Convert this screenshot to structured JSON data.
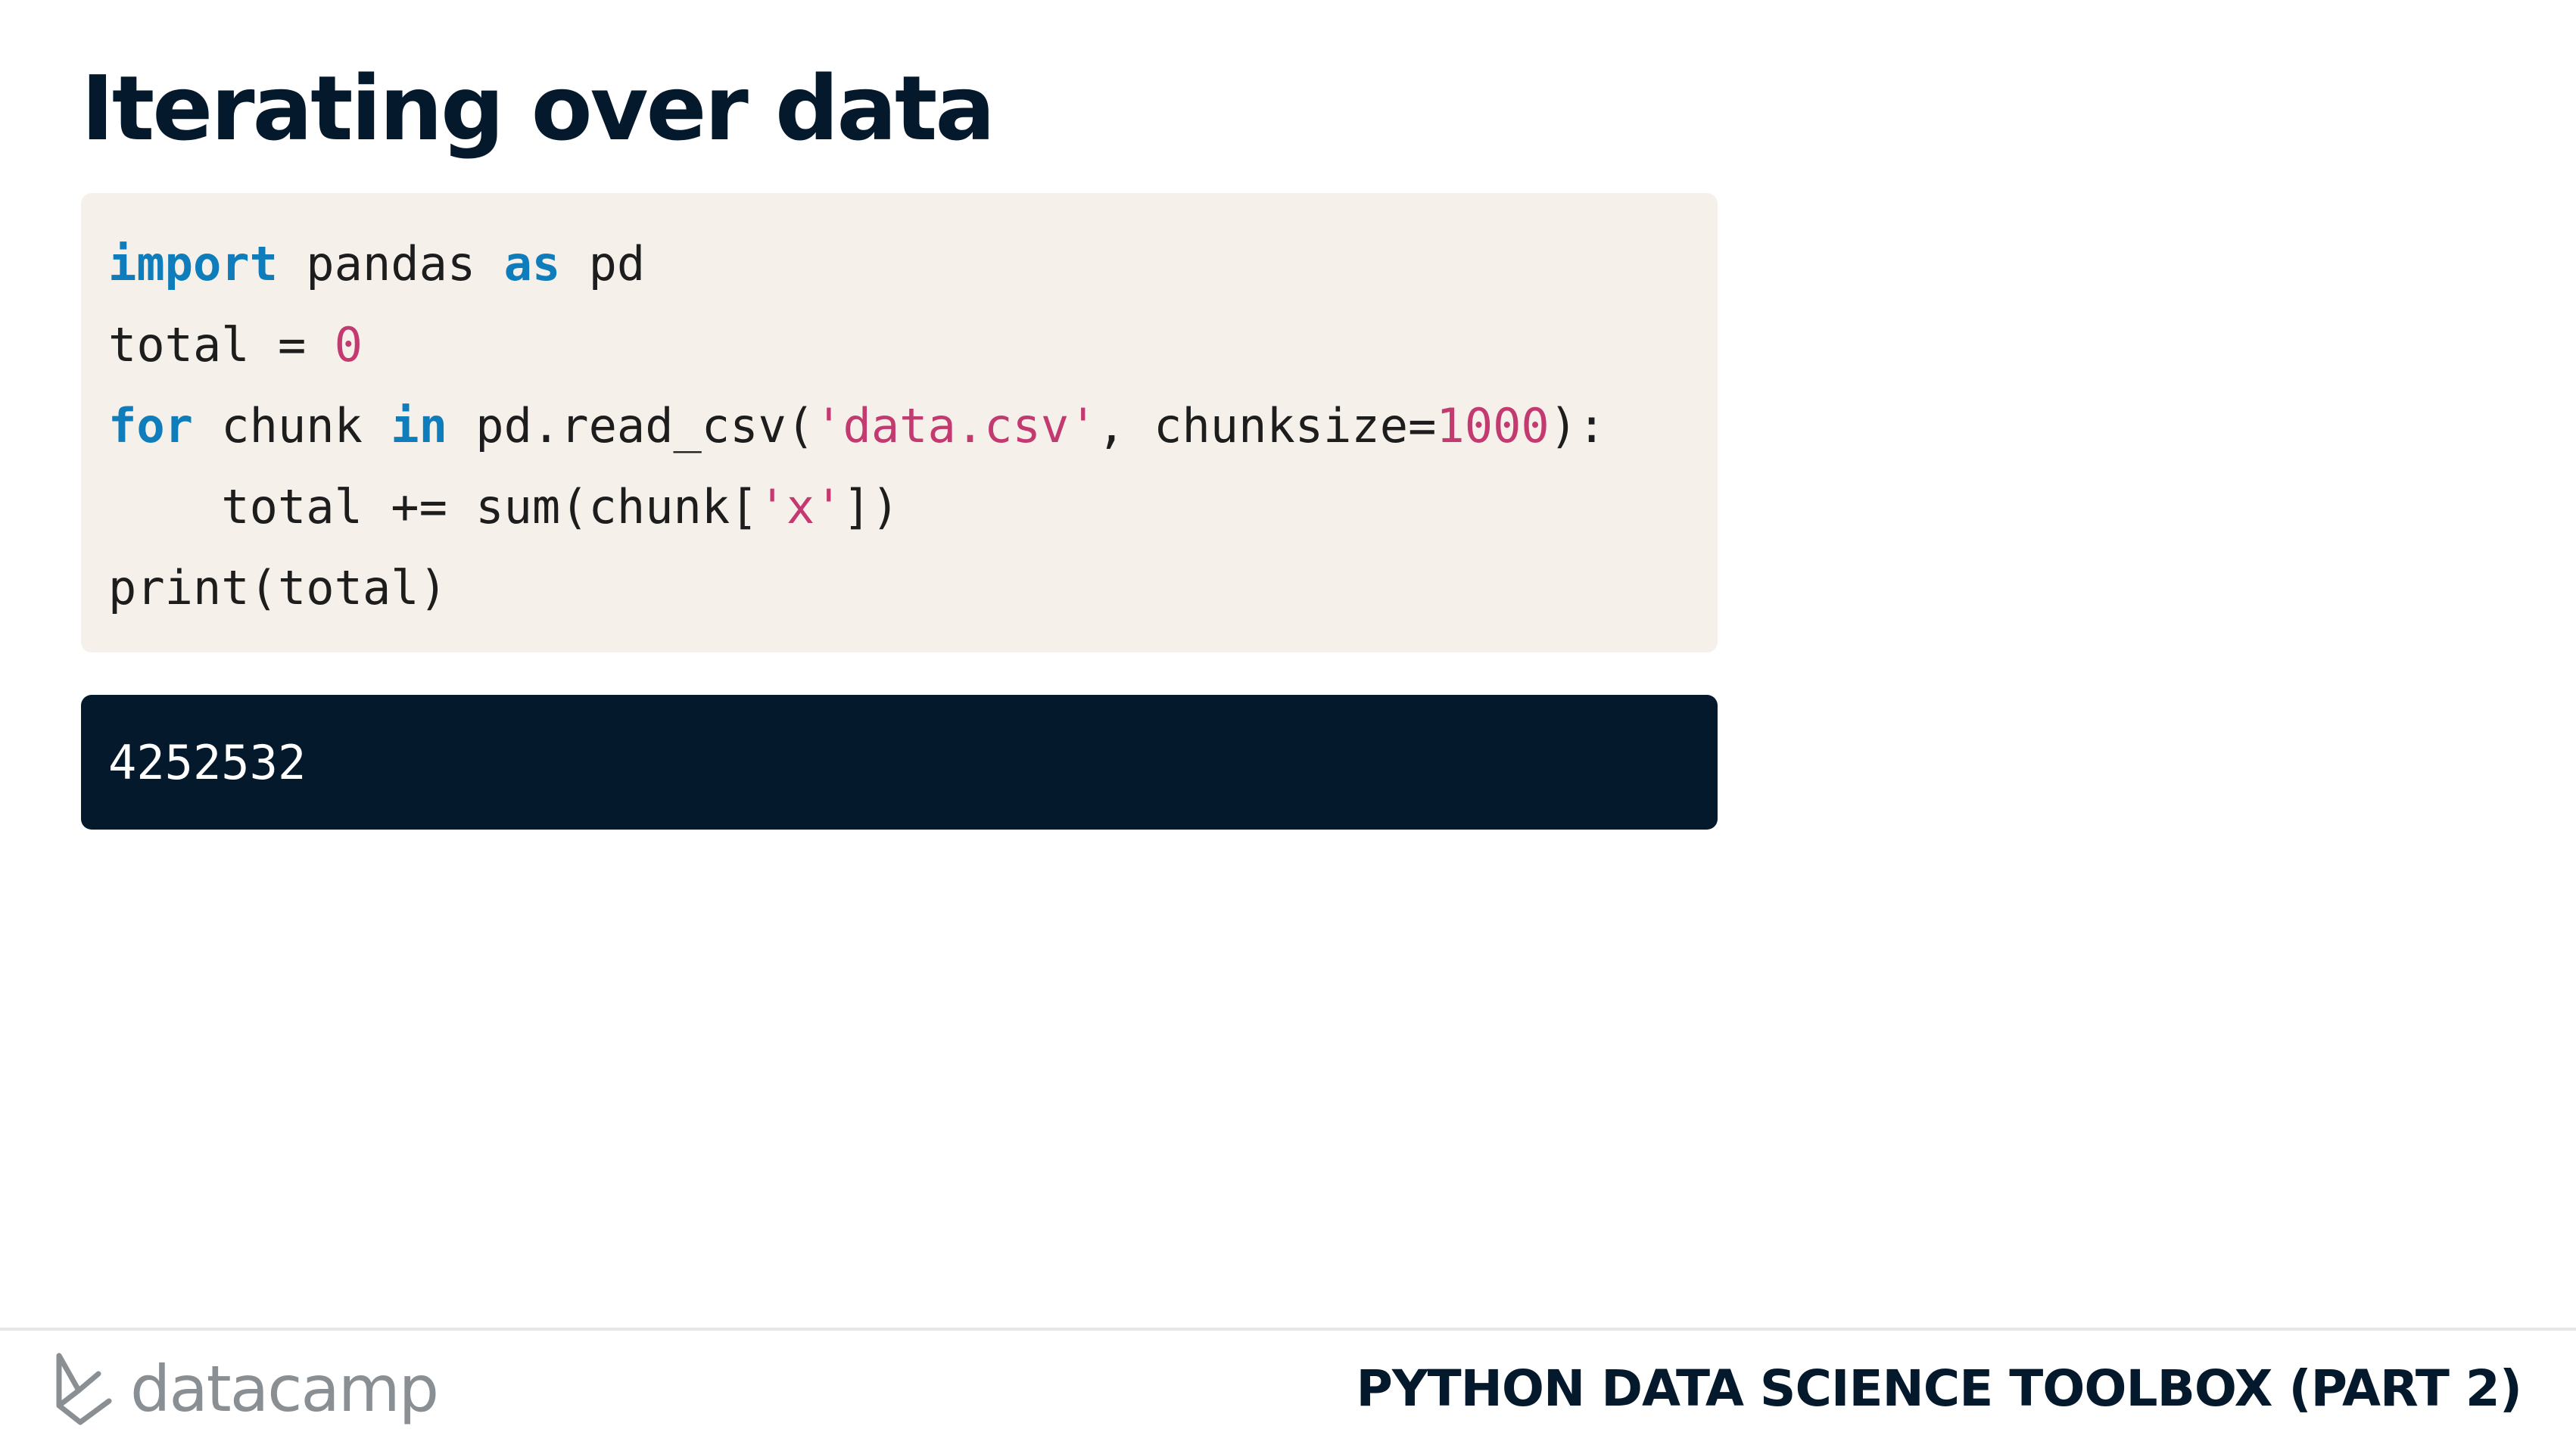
{
  "slide": {
    "title": "Iterating over data"
  },
  "code": {
    "line1": {
      "kw1": "import",
      "t1": " pandas ",
      "kw2": "as",
      "t2": " pd"
    },
    "line2": {
      "t1": "total = ",
      "num1": "0"
    },
    "line3": {
      "kw1": "for",
      "t1": " chunk ",
      "kw2": "in",
      "t2": " pd.read_csv(",
      "str1": "'data.csv'",
      "t3": ", chunksize=",
      "num1": "1000",
      "t4": "):"
    },
    "line4": {
      "t1": "    total += sum(chunk[",
      "str1": "'x'",
      "t2": "])"
    },
    "line5": {
      "t1": "print(total)"
    }
  },
  "output": {
    "text": "4252532"
  },
  "footer": {
    "brand": "datacamp",
    "brand_icon": "datacamp-logo-icon",
    "course": "PYTHON DATA SCIENCE TOOLBOX (PART 2)"
  },
  "colors": {
    "title": "#05192d",
    "code_background": "#f5f1ea",
    "keyword": "#0f7dbb",
    "string_literal": "#c23a6f",
    "output_background": "#05192d",
    "brand_gray": "#8a8f94"
  }
}
